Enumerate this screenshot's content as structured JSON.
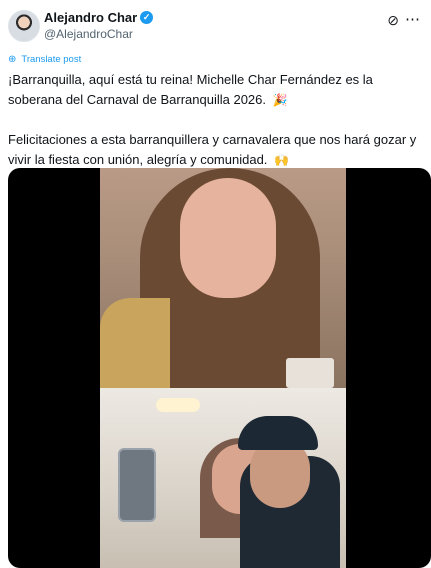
{
  "author": {
    "name": "Alejandro Char",
    "handle": "@AlejandroChar"
  },
  "icons": {
    "grok": "grok-icon",
    "more": "more-options-icon",
    "verified": "verified-badge-icon",
    "translate": "globe-icon"
  },
  "translate_label": "Translate post",
  "tweet": {
    "paragraph1": "¡Barranquilla, aquí está tu reina! Michelle Char Fernández es la soberana del Carnaval de Barranquilla 2026.",
    "paragraph1_emoji": "🎉",
    "paragraph2": "Felicitaciones a esta barranquillera y carnavalera que nos hará gozar y vivir la fiesta con unión, alegría y comunidad.",
    "paragraph2_emoji": "🙌"
  },
  "colors": {
    "link": "#1d9bf0",
    "text": "#0f1419",
    "muted": "#536471"
  }
}
